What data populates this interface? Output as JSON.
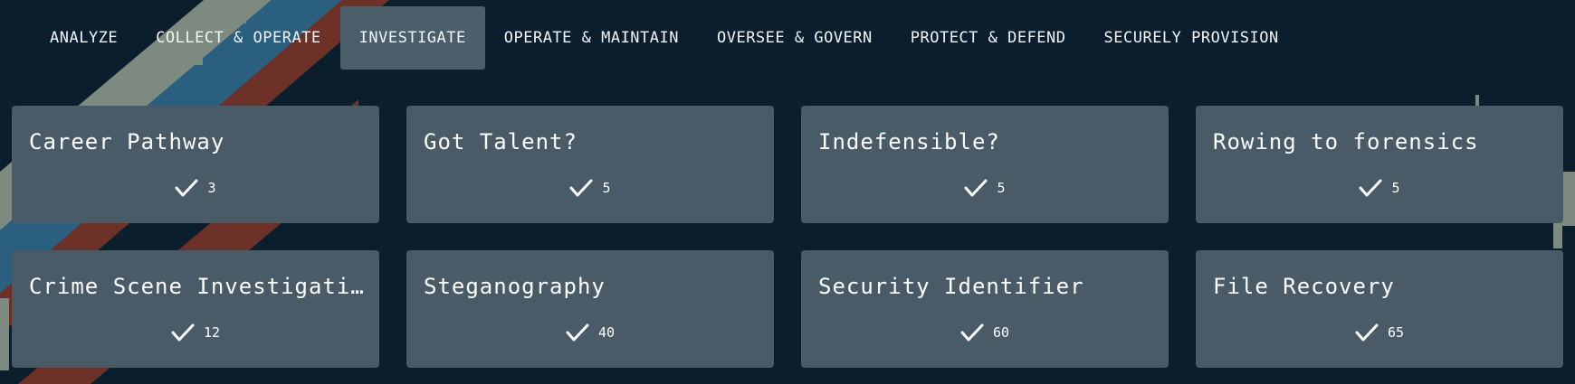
{
  "nav": {
    "tabs": [
      {
        "label": "ANALYZE",
        "active": false
      },
      {
        "label": "COLLECT & OPERATE",
        "active": false
      },
      {
        "label": "INVESTIGATE",
        "active": true
      },
      {
        "label": "OPERATE & MAINTAIN",
        "active": false
      },
      {
        "label": "OVERSEE & GOVERN",
        "active": false
      },
      {
        "label": "PROTECT & DEFEND",
        "active": false
      },
      {
        "label": "SECURELY PROVISION",
        "active": false
      }
    ]
  },
  "cards": [
    {
      "title": "Career Pathway",
      "count": "3",
      "icon": "check-icon"
    },
    {
      "title": "Got Talent?",
      "count": "5",
      "icon": "check-icon"
    },
    {
      "title": "Indefensible?",
      "count": "5",
      "icon": "check-icon"
    },
    {
      "title": "Rowing to forensics",
      "count": "5",
      "icon": "check-icon"
    },
    {
      "title": "Crime Scene Investigati…",
      "count": "12",
      "icon": "check-icon"
    },
    {
      "title": "Steganography",
      "count": "40",
      "icon": "check-icon"
    },
    {
      "title": "Security Identifier",
      "count": "60",
      "icon": "check-icon"
    },
    {
      "title": "File Recovery",
      "count": "65",
      "icon": "check-icon"
    }
  ],
  "colors": {
    "background": "#0b1e2e",
    "card": "#485b66",
    "active_tab": "#4b5f6b",
    "stripe_gray": "#7d8a80",
    "stripe_blue": "#2a5f7f",
    "stripe_red": "#6d3128"
  }
}
